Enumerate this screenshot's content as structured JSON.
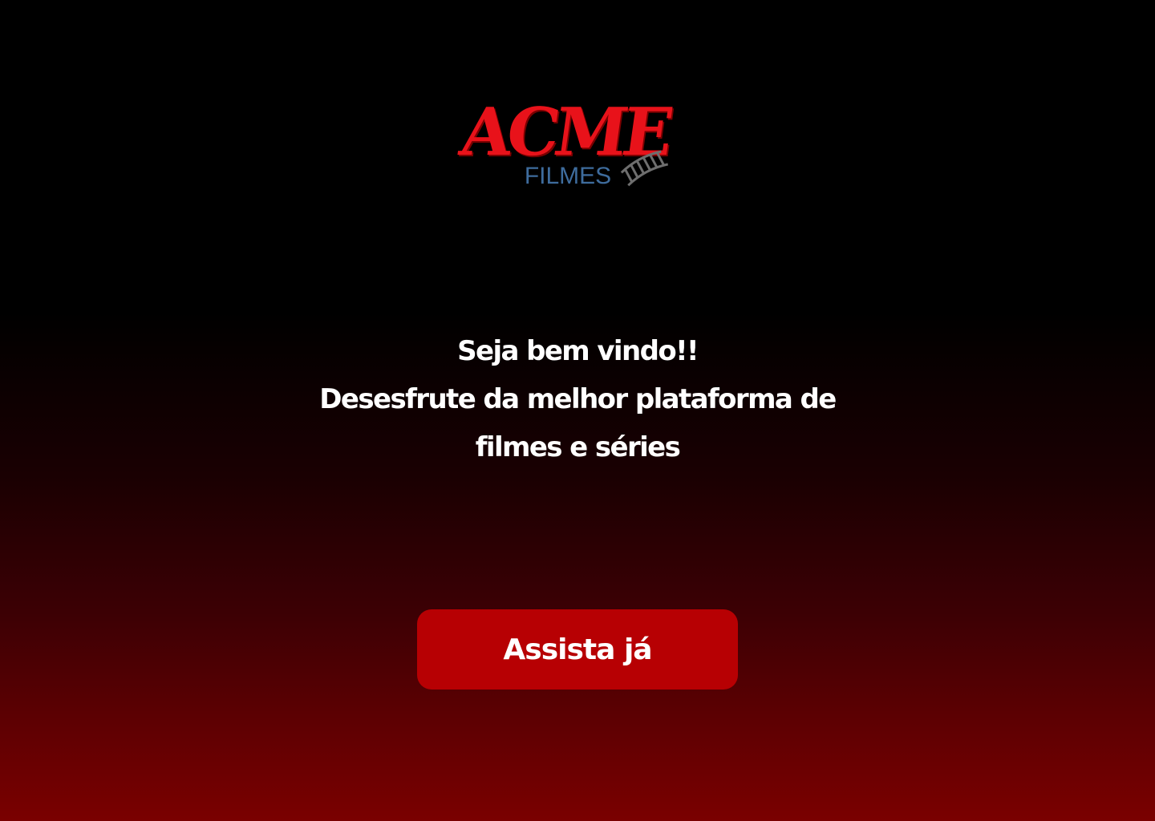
{
  "logo": {
    "wordmark": "ACME",
    "subtitle": "FILMES",
    "icon": "film-strip-icon",
    "colors": {
      "wordmark": "#e8121a",
      "wordmark_shadow": "#7a0000",
      "subtitle": "#3e6c9d",
      "film_strip": "#6e6e6e"
    }
  },
  "headline": {
    "line1": "Seja bem vindo!!",
    "line2": "Desesfrute da melhor plataforma de",
    "line3": "filmes e séries"
  },
  "cta": {
    "label": "Assista já",
    "color": "#b70003"
  },
  "theme": {
    "background_top": "#000000",
    "background_bottom": "#7a0000",
    "text": "#ffffff"
  }
}
